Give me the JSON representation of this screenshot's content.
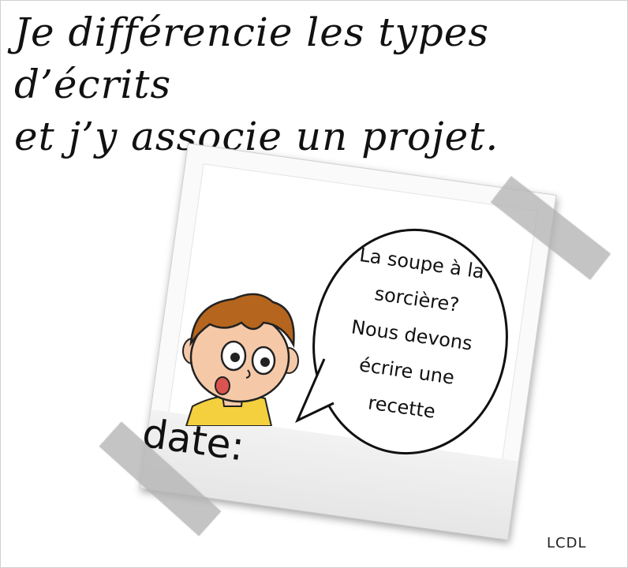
{
  "title": {
    "line1": "Je différencie les types d’écrits",
    "line2": "et j’y associe un projet."
  },
  "speech_bubble": {
    "lines": [
      "La soupe à la",
      "sorcière?",
      "Nous devons",
      "écrire une",
      "recette"
    ]
  },
  "date_label": "date:",
  "credit": "LCDL",
  "colors": {
    "hair": "#b5651d",
    "skin": "#f5c9a8",
    "shirt": "#f4d03f",
    "tape": "#b4b4b4"
  },
  "icons": {
    "character": "boy-illustration",
    "bubble": "speech-bubble"
  }
}
